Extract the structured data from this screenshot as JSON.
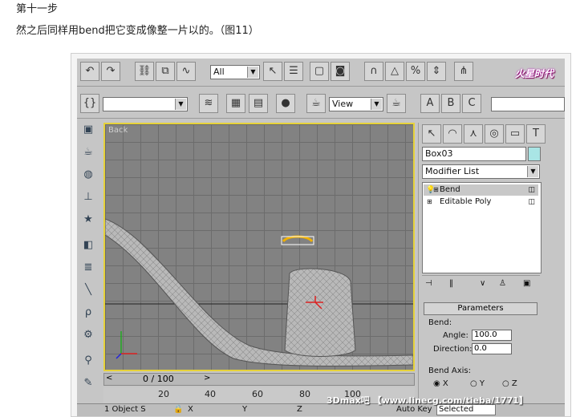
{
  "article": {
    "step": "第十一步",
    "description": "然之后同样用bend把它变成像整一片以的。（图11）"
  },
  "toolbar1": {
    "selection_filter": "All",
    "logo_text": "火星时代"
  },
  "toolbar2": {
    "named_selection": "",
    "view_label": "View"
  },
  "viewport": {
    "label": "Back"
  },
  "command_panel": {
    "object_name": "Box03",
    "modifier_list": "Modifier List",
    "stack": [
      "Bend",
      "Editable Poly"
    ],
    "parameters_title": "Parameters",
    "bend_group": "Bend:",
    "angle_label": "Angle:",
    "angle_value": "100.0",
    "direction_label": "Direction:",
    "direction_value": "0.0",
    "bend_axis_label": "Bend Axis:",
    "axis_x": "X",
    "axis_y": "Y",
    "axis_z": "Z"
  },
  "timeline": {
    "frame": "0 / 100",
    "ticks": [
      "20",
      "40",
      "60",
      "80",
      "100"
    ]
  },
  "statusbar": {
    "object_s": "1 Object S",
    "x_label": "X",
    "y_label": "Y",
    "z_label": "Z",
    "auto_key": "Auto Key",
    "selected": "Selected"
  },
  "watermark": "3Dmax吧 【www.linecg.com/tieba/1771】"
}
